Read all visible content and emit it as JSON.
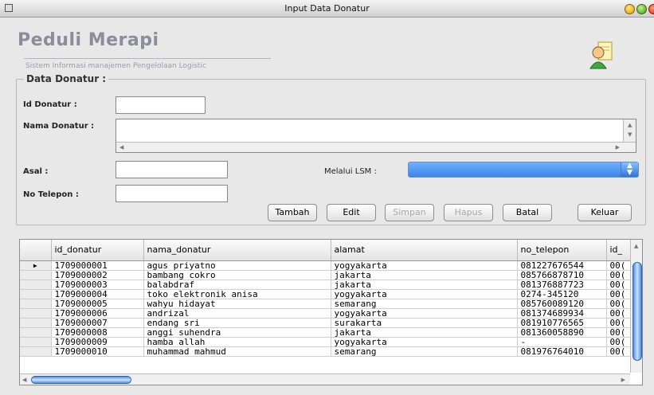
{
  "window": {
    "title": "Input Data Donatur"
  },
  "header": {
    "brand": "Peduli Merapi",
    "tagline": "Sistem Informasi manajemen Pengelolaan Logistic"
  },
  "form": {
    "group_title": "Data Donatur :",
    "id_label": "Id Donatur :",
    "id_value": "",
    "nama_label": "Nama Donatur :",
    "nama_value": "",
    "asal_label": "Asal :",
    "asal_value": "",
    "lsm_label": "Melalui LSM :",
    "lsm_value": "",
    "telepon_label": "No Telepon :",
    "telepon_value": ""
  },
  "buttons": {
    "tambah": "Tambah",
    "edit": "Edit",
    "simpan": "Simpan",
    "hapus": "Hapus",
    "batal": "Batal",
    "keluar": "Keluar"
  },
  "table": {
    "columns": [
      "id_donatur",
      "nama_donatur",
      "alamat",
      "no_telepon",
      "id_"
    ],
    "rows": [
      [
        "1709000001",
        "agus priyatno",
        "yogyakarta",
        "081227676544",
        "00("
      ],
      [
        "1709000002",
        "bambang cokro",
        "jakarta",
        "085766878710",
        "00("
      ],
      [
        "1709000003",
        "balabdraf",
        "jakarta",
        "081376887723",
        "00("
      ],
      [
        "1709000004",
        "toko elektronik anisa",
        "yogyakarta",
        "0274-345120",
        "00("
      ],
      [
        "1709000005",
        "wahyu hidayat",
        "semarang",
        "085760089120",
        "00("
      ],
      [
        "1709000006",
        "andrizal",
        "yogyakarta",
        "081374689934",
        "00("
      ],
      [
        "1709000007",
        "endang sri",
        "surakarta",
        "081910776565",
        "00("
      ],
      [
        "1709000008",
        "anggi suhendra",
        "jakarta",
        "081360058890",
        "00("
      ],
      [
        "1709000009",
        "hamba allah",
        "yogyakarta",
        "-",
        "00("
      ],
      [
        "1709000010",
        "muhammad mahmud",
        "semarang",
        "081976764010",
        "00("
      ]
    ],
    "current_row_marker": "▶"
  },
  "icons": {
    "app": "window-icon",
    "user": "user-document-icon",
    "combo": "updown-arrow-icon"
  },
  "colors": {
    "combo_selected": "#3d86e8",
    "scroll_thumb": "#4a8ee8"
  }
}
